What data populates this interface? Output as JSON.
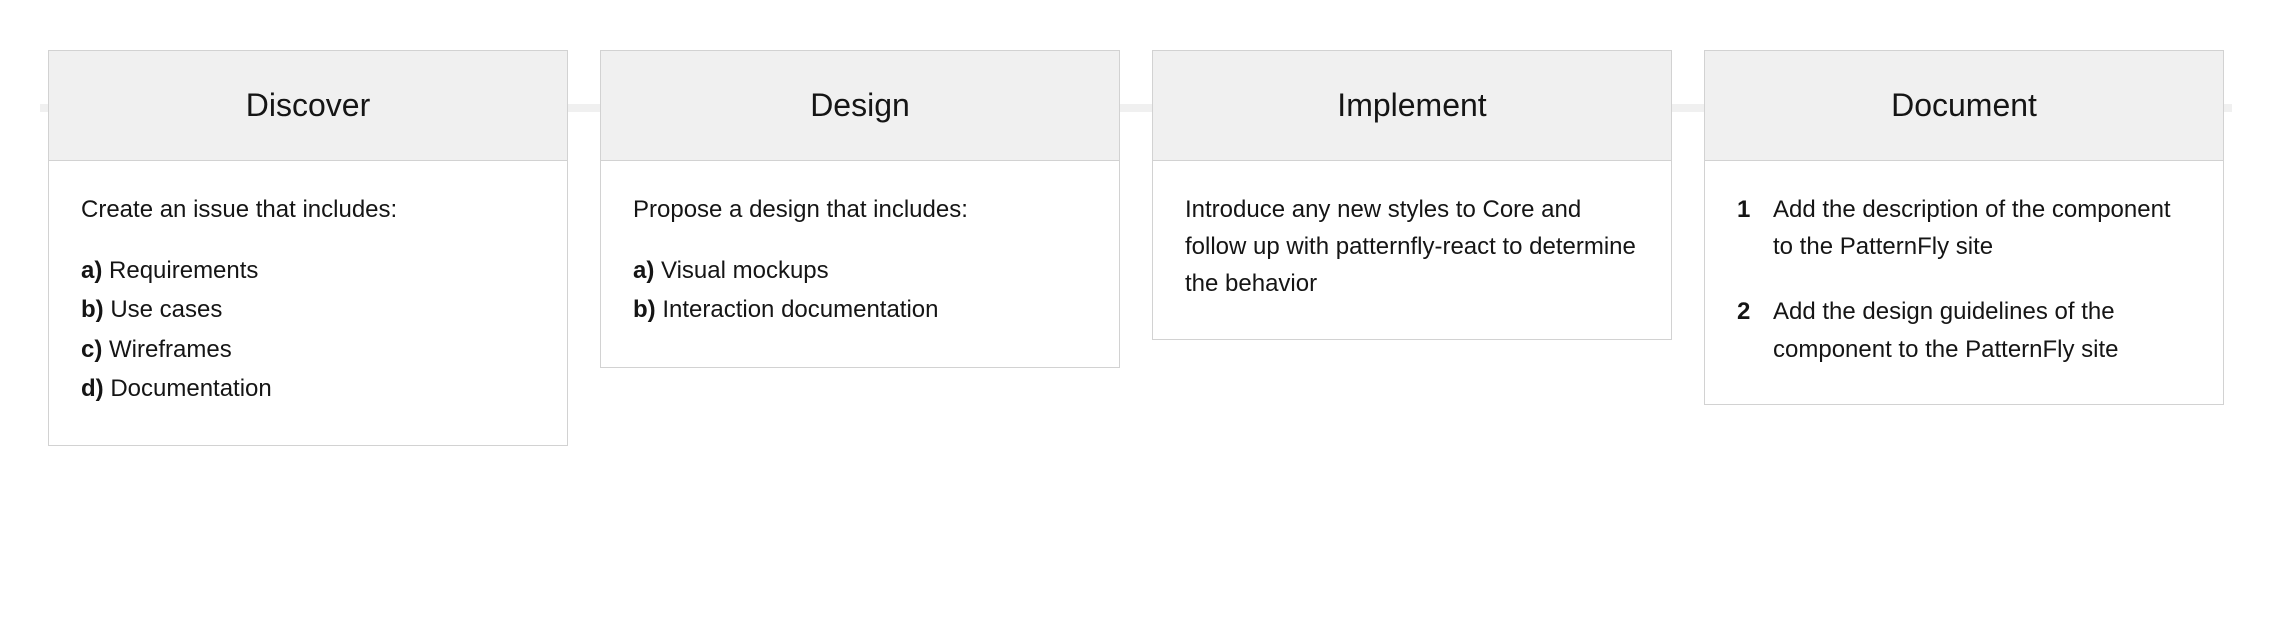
{
  "steps": [
    {
      "title": "Discover",
      "lead": "Create an issue that includes:",
      "items": [
        {
          "marker": "a)",
          "text": "Requirements"
        },
        {
          "marker": "b)",
          "text": "Use cases"
        },
        {
          "marker": "c)",
          "text": "Wireframes"
        },
        {
          "marker": "d)",
          "text": "Documentation"
        }
      ]
    },
    {
      "title": "Design",
      "lead": "Propose a design that includes:",
      "items": [
        {
          "marker": "a)",
          "text": "Visual mockups"
        },
        {
          "marker": "b)",
          "text": "Interaction documentation"
        }
      ]
    },
    {
      "title": "Implement",
      "paragraph": "Introduce any new styles to Core and follow up with patternfly-react to determine the behavior"
    },
    {
      "title": "Document",
      "numbered": [
        {
          "n": "1",
          "text": "Add the description of the component to the PatternFly site"
        },
        {
          "n": "2",
          "text": "Add the design guidelines of the component to the PatternFly site"
        }
      ]
    }
  ]
}
